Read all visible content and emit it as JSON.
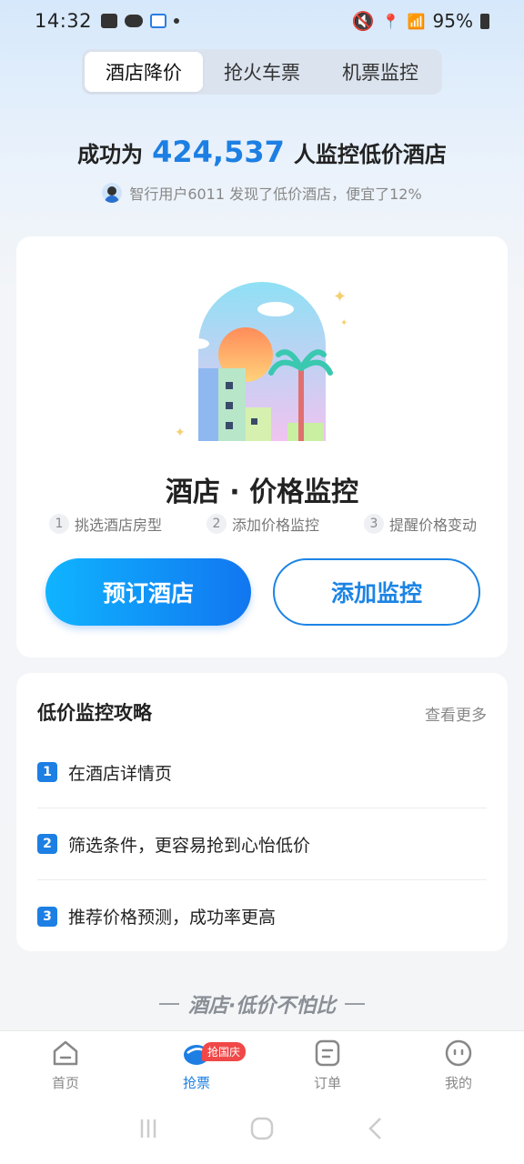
{
  "status_bar": {
    "time": "14:32",
    "battery": "95%"
  },
  "tabs": [
    {
      "label": "酒店降价"
    },
    {
      "label": "抢火车票"
    },
    {
      "label": "机票监控"
    }
  ],
  "headline": {
    "prefix": "成功为",
    "count": "424,537",
    "suffix": "人监控低价酒店"
  },
  "subline": {
    "text": "智行用户6011 发现了低价酒店，便宜了12%"
  },
  "main_card": {
    "title": "酒店 · 价格监控",
    "steps": [
      {
        "num": "1",
        "label": "挑选酒店房型"
      },
      {
        "num": "2",
        "label": "添加价格监控"
      },
      {
        "num": "3",
        "label": "提醒价格变动"
      }
    ],
    "book_button": "预订酒店",
    "monitor_button": "添加监控"
  },
  "guide": {
    "title": "低价监控攻略",
    "more": "查看更多",
    "items": [
      {
        "num": "1",
        "label": "在酒店详情页"
      },
      {
        "num": "2",
        "label": "筛选条件，更容易抢到心怡低价"
      },
      {
        "num": "3",
        "label": "推荐价格预测，成功率更高"
      }
    ]
  },
  "slogan": "酒店·低价不怕比",
  "bottom_nav": {
    "items": [
      {
        "label": "首页"
      },
      {
        "label": "抢票",
        "badge": "抢国庆"
      },
      {
        "label": "订单"
      },
      {
        "label": "我的"
      }
    ]
  },
  "colors": {
    "accent": "#1d7fe3",
    "badge": "#f04848"
  }
}
